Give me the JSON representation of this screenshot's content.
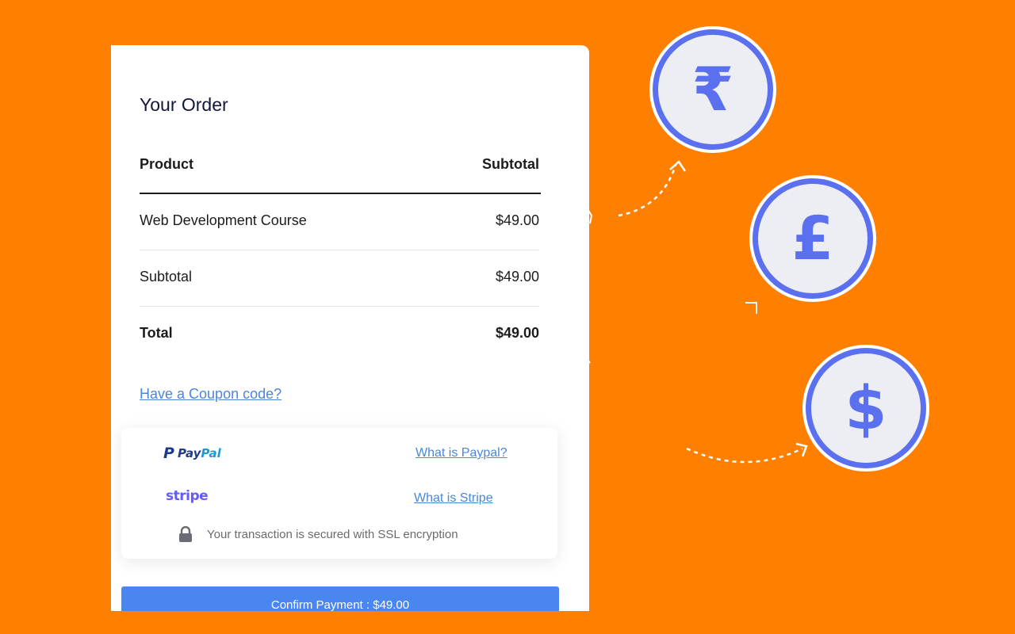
{
  "order": {
    "title": "Your Order",
    "columns": {
      "product": "Product",
      "subtotal": "Subtotal"
    },
    "items": [
      {
        "name": "Web Development Course",
        "price": "$49.00"
      }
    ],
    "subtotal": {
      "label": "Subtotal",
      "value": "$49.00"
    },
    "total": {
      "label": "Total",
      "value": "$49.00"
    },
    "coupon_link": "Have a Coupon code?"
  },
  "payment": {
    "paypal": {
      "logo_pay": "Pay",
      "logo_pal": "Pal",
      "link": "What is Paypal?"
    },
    "stripe": {
      "logo": "stripe",
      "link": "What is Stripe"
    },
    "ssl_text": "Your transaction is secured with SSL encryption"
  },
  "confirm_button": "Confirm Payment : $49.00",
  "currency_coins": [
    {
      "symbol": "₹",
      "icon": "rupee-icon"
    },
    {
      "symbol": "£",
      "icon": "pound-icon"
    },
    {
      "symbol": "$",
      "icon": "dollar-icon"
    }
  ],
  "colors": {
    "background": "#FF8000",
    "accent_blue": "#4a86f0",
    "link_blue": "#4b86d8",
    "coin_blue": "#5b70ef",
    "stripe_purple": "#635bff"
  }
}
